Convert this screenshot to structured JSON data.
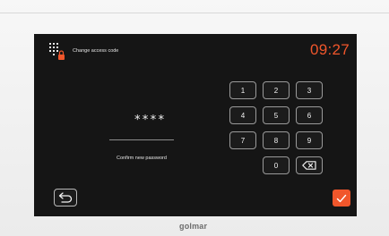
{
  "header": {
    "title": "Change access code",
    "clock": "09:27",
    "icon": "keypad-lock-icon"
  },
  "entry": {
    "masked_value": "****",
    "prompt": "Confirm new password"
  },
  "keypad": {
    "keys": [
      "1",
      "2",
      "3",
      "4",
      "5",
      "6",
      "7",
      "8",
      "9",
      "0"
    ],
    "backspace_icon": "backspace-icon"
  },
  "footer": {
    "back_icon": "return-arrow-icon",
    "confirm_icon": "checkmark-icon"
  },
  "brand": "golmar",
  "colors": {
    "accent": "#f0562b",
    "screen_bg": "#151515",
    "text": "#f2f2f2"
  }
}
